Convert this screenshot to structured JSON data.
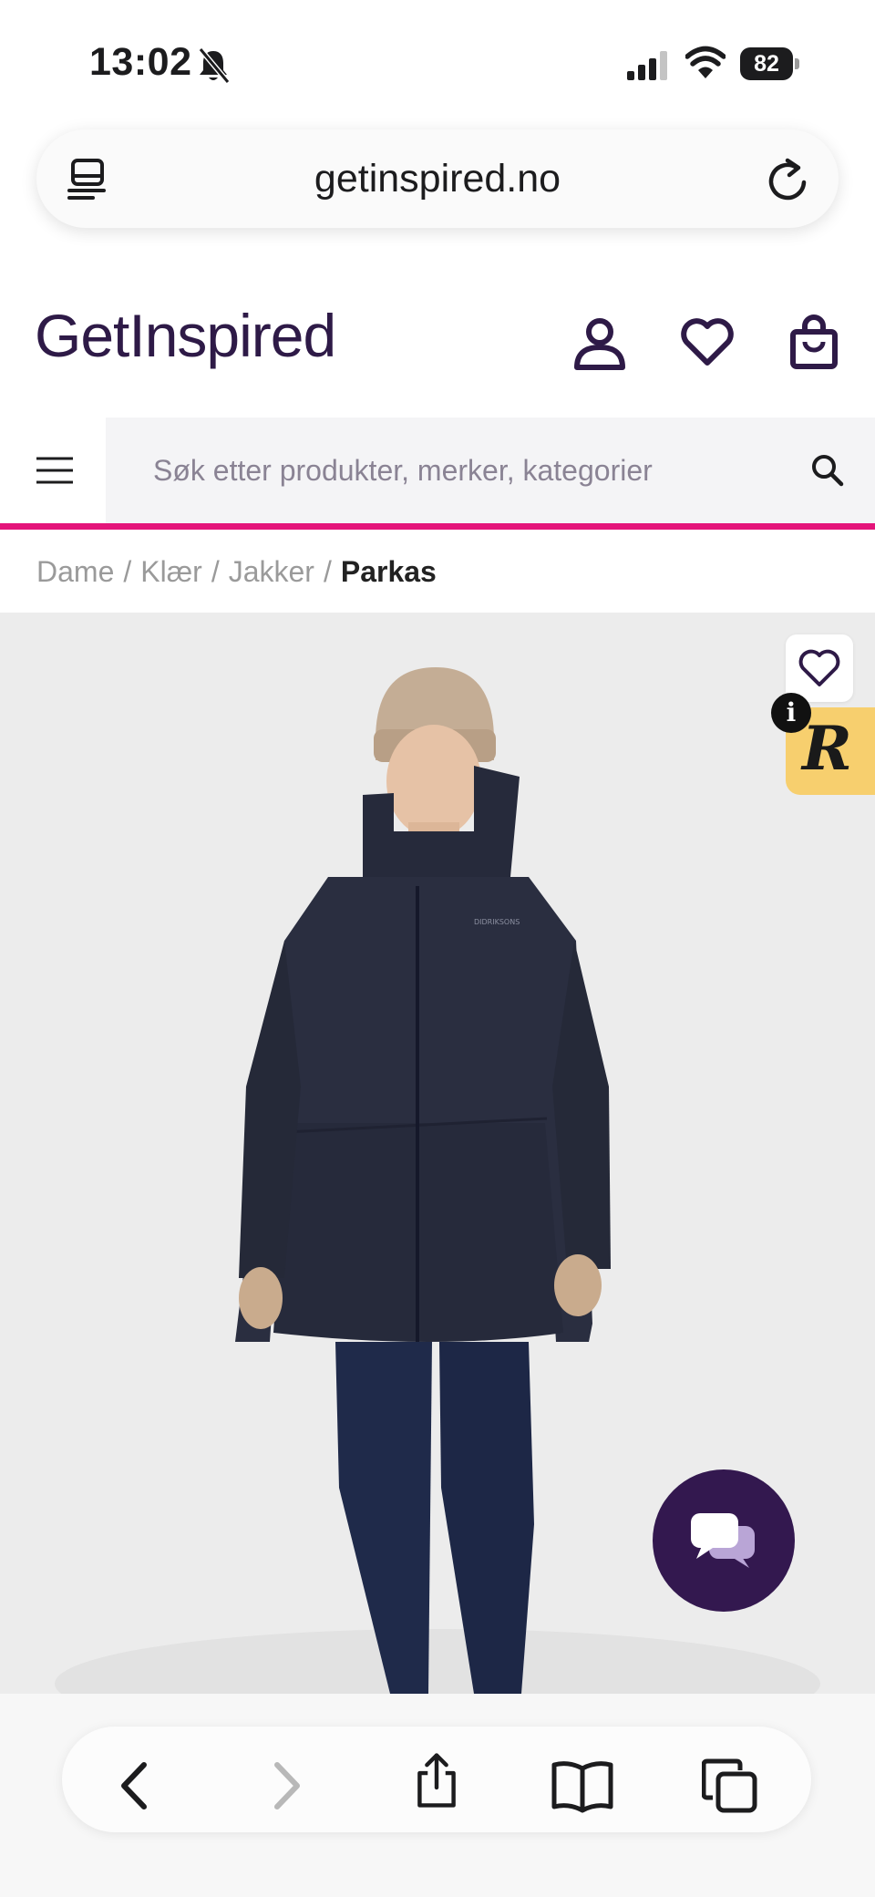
{
  "status_bar": {
    "time": "13:02",
    "battery": "82",
    "icons": [
      "bell-slash-icon",
      "signal-icon",
      "wifi-icon",
      "battery-icon"
    ]
  },
  "browser": {
    "url": "getinspired.no",
    "icons": [
      "reader-icon",
      "reload-icon"
    ]
  },
  "header": {
    "logo": "GetInspired",
    "brand_color": "#2e1a47",
    "icons": [
      "user-icon",
      "heart-icon",
      "bag-icon"
    ]
  },
  "search": {
    "placeholder": "Søk etter produkter, merker, kategorier",
    "accent_color": "#e4147a"
  },
  "breadcrumb": {
    "items": [
      "Dame",
      "Klær",
      "Jakker"
    ],
    "separator": "/",
    "current": "Parkas"
  },
  "product": {
    "image_icon": "product-photo-parka",
    "badge_letter": "R",
    "info_glyph": "i"
  },
  "toolbar": {
    "icons": [
      "back-icon",
      "forward-icon",
      "share-icon",
      "bookmarks-icon",
      "tabs-icon"
    ]
  }
}
